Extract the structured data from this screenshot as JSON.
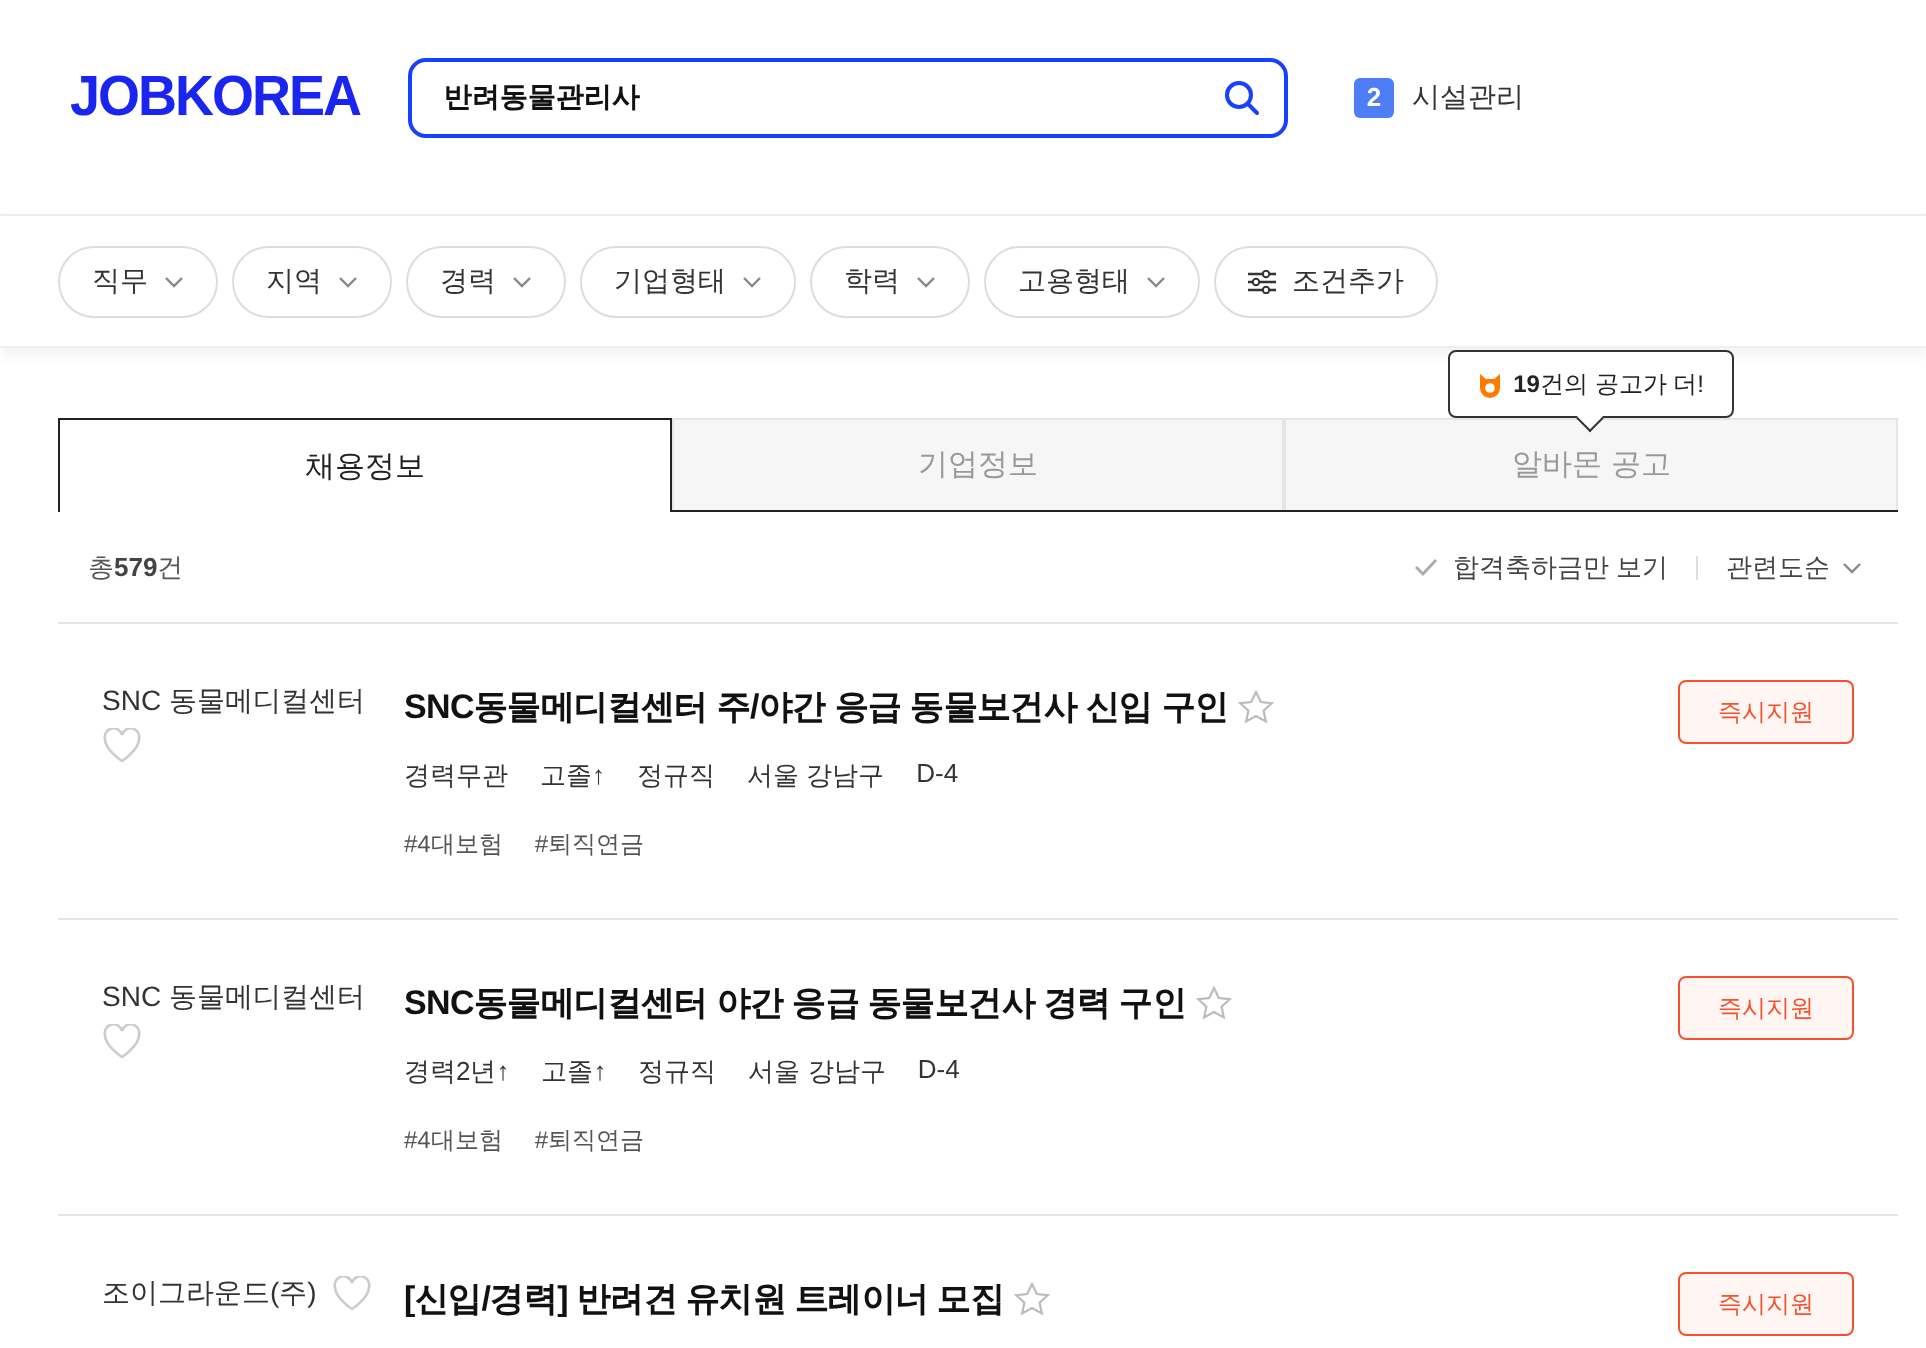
{
  "header": {
    "logo": "JOBKOREA",
    "search": {
      "value": "반려동물관리사"
    },
    "badge": "2",
    "facility": "시설관리"
  },
  "filters": [
    {
      "label": "직무",
      "kind": "dropdown"
    },
    {
      "label": "지역",
      "kind": "dropdown"
    },
    {
      "label": "경력",
      "kind": "dropdown"
    },
    {
      "label": "기업형태",
      "kind": "dropdown"
    },
    {
      "label": "학력",
      "kind": "dropdown"
    },
    {
      "label": "고용형태",
      "kind": "dropdown"
    },
    {
      "label": "조건추가",
      "kind": "add"
    }
  ],
  "tooltip": "**19**건의 공고가 더!",
  "tabs": [
    {
      "label": "채용정보",
      "selected": true
    },
    {
      "label": "기업정보",
      "selected": false
    },
    {
      "label": "알바몬 공고",
      "selected": false
    }
  ],
  "result_count": "총**579**건",
  "bonus_filter": {
    "label": "합격축하금만 보기",
    "checked": false
  },
  "sort": "관련도순",
  "jobs": [
    {
      "company": "SNC 동물메디컬센터",
      "title": "SNC동물메디컬센터 주/야간 응급 동물보건사 신입 구인",
      "conditions": [
        "경력무관",
        "고졸↑",
        "정규직",
        "서울 강남구",
        "D-4"
      ],
      "tags": [
        "#4대보험",
        "#퇴직연금"
      ],
      "apply": "즉시지원"
    },
    {
      "company": "SNC 동물메디컬센터",
      "title": "SNC동물메디컬센터 야간 응급 동물보건사 경력 구인",
      "conditions": [
        "경력2년↑",
        "고졸↑",
        "정규직",
        "서울 강남구",
        "D-4"
      ],
      "tags": [
        "#4대보험",
        "#퇴직연금"
      ],
      "apply": "즉시지원"
    },
    {
      "company": "조이그라운드(주)",
      "title": "[신입/경력] 반려견 유치원 트레이너 모집",
      "apply": "즉시지원"
    }
  ]
}
